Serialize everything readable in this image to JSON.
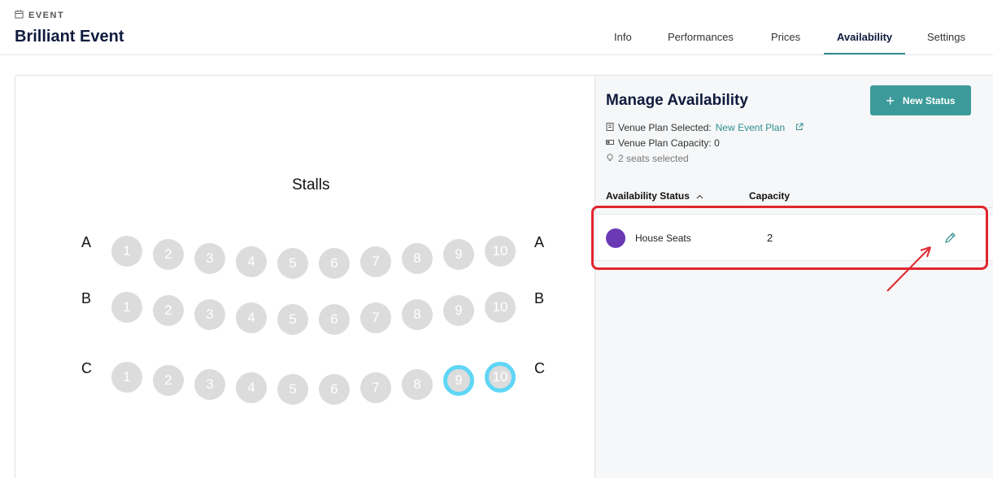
{
  "header": {
    "section_label": "EVENT",
    "title": "Brilliant Event",
    "tabs": [
      {
        "label": "Info"
      },
      {
        "label": "Performances"
      },
      {
        "label": "Prices"
      },
      {
        "label": "Availability"
      },
      {
        "label": "Settings"
      }
    ],
    "active_tab": "Availability"
  },
  "seatmap": {
    "section": "Stalls",
    "rows": [
      {
        "label": "A",
        "seats": [
          "1",
          "2",
          "3",
          "4",
          "5",
          "6",
          "7",
          "8",
          "9",
          "10"
        ]
      },
      {
        "label": "B",
        "seats": [
          "1",
          "2",
          "3",
          "4",
          "5",
          "6",
          "7",
          "8",
          "9",
          "10"
        ]
      },
      {
        "label": "C",
        "seats": [
          "1",
          "2",
          "3",
          "4",
          "5",
          "6",
          "7",
          "8",
          "9",
          "10"
        ]
      }
    ],
    "selected_seats": [
      "C9",
      "C10"
    ]
  },
  "panel": {
    "title": "Manage Availability",
    "new_status_label": "New Status",
    "venue_plan_label": "Venue Plan Selected:",
    "venue_plan_value": "New Event Plan",
    "capacity_text": "Venue Plan Capacity: 0",
    "selection_text": "2 seats selected",
    "table": {
      "col_status": "Availability Status",
      "col_capacity": "Capacity",
      "rows": [
        {
          "name": "House Seats",
          "capacity": "2",
          "color": "#6a3ab5"
        }
      ]
    }
  },
  "colors": {
    "accent": "#3c9b9a",
    "seat": "#dcdcdc",
    "seat_selected_ring": "#5fd6f5",
    "annotation": "#e0262e"
  }
}
